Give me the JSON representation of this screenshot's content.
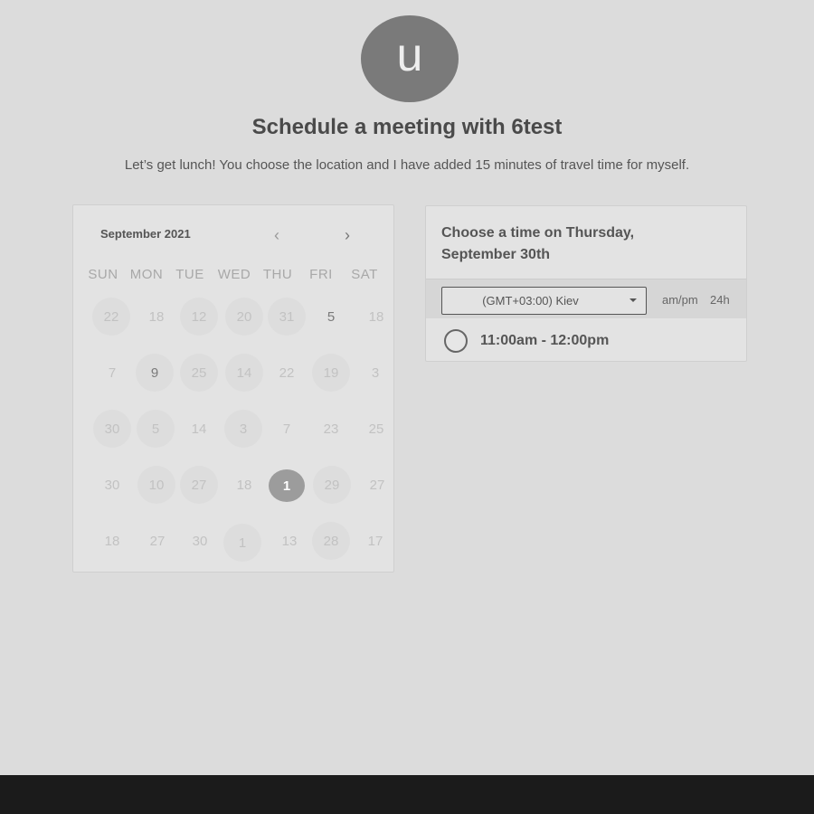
{
  "host": {
    "avatar_letter": "u",
    "title": "Schedule a meeting with 6test",
    "description": "Let’s get lunch! You choose the location and I have added 15 minutes of travel time for myself."
  },
  "calendar": {
    "month_label": "September 2021",
    "prev_icon": "chevron-left-icon",
    "next_icon": "chevron-right-icon",
    "prev_glyph": "‹",
    "next_glyph": "›",
    "weekdays": [
      "SUN",
      "MON",
      "TUE",
      "WED",
      "THU",
      "FRI",
      "SAT"
    ],
    "weeks": [
      [
        "22",
        "18",
        "12",
        "20",
        "31",
        "5",
        "18"
      ],
      [
        "7",
        "9",
        "25",
        "14",
        "22",
        "19",
        "3"
      ],
      [
        "30",
        "5",
        "14",
        "3",
        "7",
        "23",
        "25"
      ],
      [
        "30",
        "10",
        "27",
        "18",
        "1",
        "29",
        "27"
      ],
      [
        "18",
        "27",
        "30",
        "1",
        "13",
        "28",
        "17"
      ]
    ],
    "selected_day": "1"
  },
  "times": {
    "heading": "Choose a time on Thursday, September 30th",
    "timezone": "(GMT+03:00) Kiev",
    "format_ampm": "am/pm",
    "format_24h": "24h",
    "slots": [
      "11:00am - 12:00pm"
    ]
  }
}
